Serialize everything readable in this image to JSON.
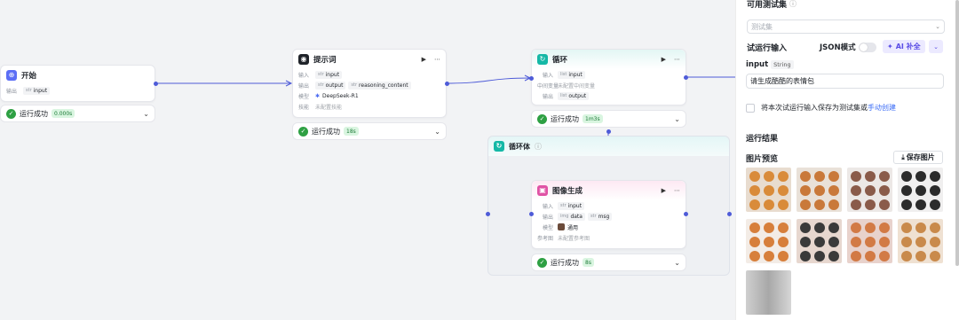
{
  "canvas": {
    "start_node": {
      "title": "开始",
      "output_label": "输出",
      "output_tag": "input",
      "output_type": "str"
    },
    "start_status": {
      "text": "运行成功",
      "time": "0.000s"
    },
    "prompt_node": {
      "title": "提示词",
      "input_label": "输入",
      "input_tag": "input",
      "input_type": "str",
      "output_label": "输出",
      "output_tag1": "output",
      "output_tag2": "reasoning_content",
      "output_type": "str",
      "model_label": "模型",
      "model_value": "DeepSeek-R1",
      "skill_label": "技能",
      "skill_value": "未配置技能"
    },
    "prompt_status": {
      "text": "运行成功",
      "time": "18s"
    },
    "loop_node": {
      "title": "循环",
      "input_label": "输入",
      "input_tag": "input",
      "input_type": "list",
      "mid_label": "中间变量",
      "mid_value": "未配置中间变量",
      "output_label": "输出",
      "output_tag": "output",
      "output_type": "list"
    },
    "loop_status": {
      "text": "运行成功",
      "time": "1m3s"
    },
    "loop_body": {
      "title": "循环体"
    },
    "image_node": {
      "title": "图像生成",
      "input_label": "输入",
      "input_tag": "input",
      "input_type": "str",
      "output_label": "输出",
      "output_tag1": "data",
      "output_tag2": "msg",
      "output_type1": "img",
      "output_type2": "str",
      "model_label": "模型",
      "model_value": "通用",
      "ref_label": "参考图",
      "ref_value": "未配置参考图"
    },
    "image_status": {
      "text": "运行成功",
      "time": "8s"
    }
  },
  "panel": {
    "dataset_title": "可用测试集",
    "dataset_placeholder": "测试集",
    "run_input_title": "试运行输入",
    "json_mode": "JSON模式",
    "ai_fill": "AI 补全",
    "input_name": "input",
    "input_type": "String",
    "input_value": "请生成酷酷的表情包",
    "save_testset_text": "将本次试运行输入保存为测试集或",
    "manual_create": "手动创建",
    "result_title": "运行结果",
    "image_preview": "图片预览",
    "save_image": "保存图片"
  },
  "colors": {
    "accent": "#4e5bd8",
    "success": "#2ea043",
    "ai": "#5b4ee6"
  }
}
